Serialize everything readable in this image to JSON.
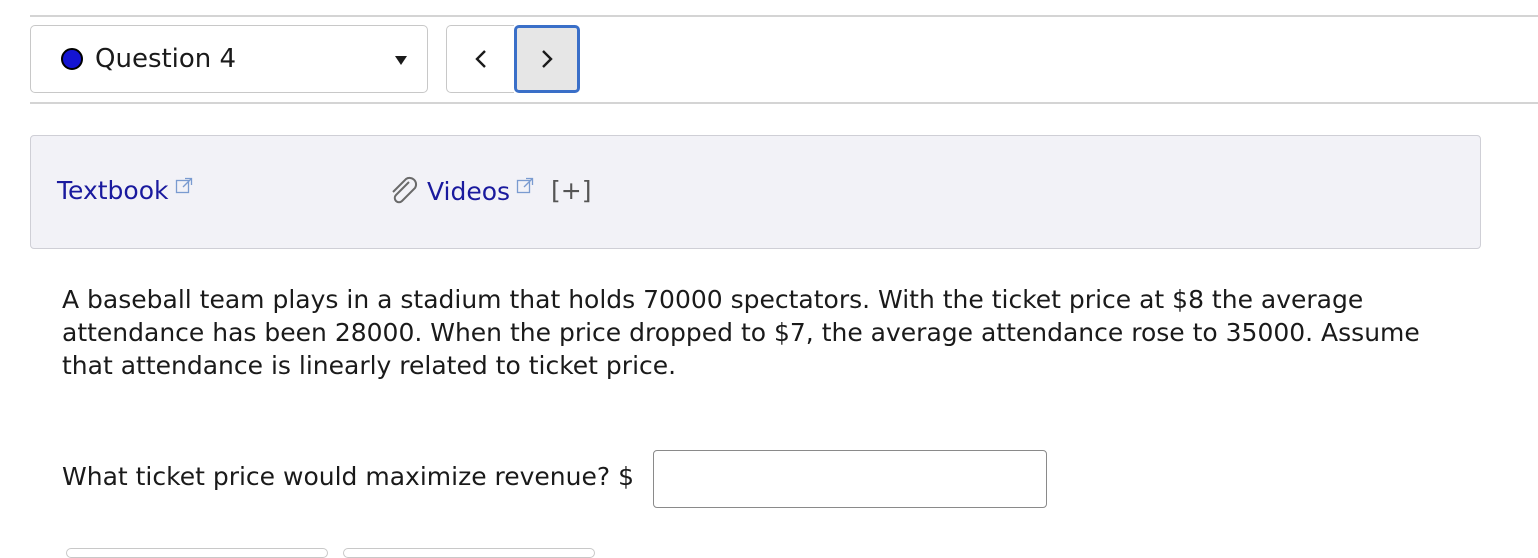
{
  "question_nav": {
    "selected_question": "Question 4",
    "status_color": "#1414d2",
    "prev_icon": "chevron-left-icon",
    "next_icon": "chevron-right-icon"
  },
  "resources": {
    "textbook_label": "Textbook",
    "videos_label": "Videos",
    "expand_label": "[+]",
    "link_color": "#1a1a9e"
  },
  "problem": {
    "lines": [
      "A baseball team plays in a stadium that holds 70000 spectators. With the ticket price at $8 the average",
      "attendance has been 28000. When the price dropped to $7, the average attendance rose to 35000. Assume",
      "that attendance is linearly related to ticket price."
    ]
  },
  "question": {
    "prompt": "What ticket price would maximize revenue? $",
    "answer_value": ""
  }
}
